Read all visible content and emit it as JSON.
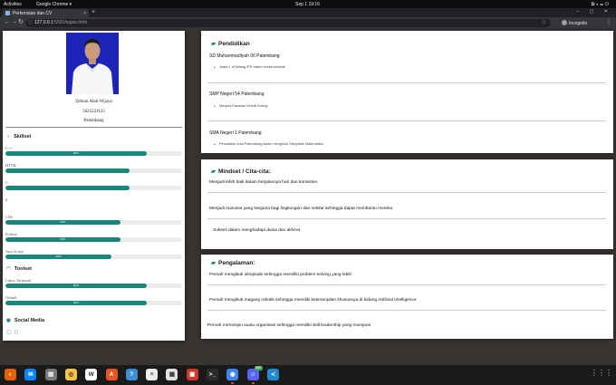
{
  "topbar": {
    "activities": "Activities",
    "app_name": "Google Chrome ▾",
    "clock": "Sep 1  19:16",
    "tray_icons": [
      "network-icon",
      "volume-icon",
      "battery-icon",
      "power-icon"
    ]
  },
  "browser": {
    "tab_title": "Perkenalan dan CV",
    "tab_close": "×",
    "new_tab": "+",
    "window_controls": "– ▢ ✕",
    "url_host": "127.0.0.1",
    "url_path": ":5501/tugas.html",
    "incognito_label": "Incognito",
    "icons": [
      "back-icon",
      "forward-icon",
      "reload-icon",
      "lock-icon",
      "star-icon",
      "menu-icon"
    ]
  },
  "profile": {
    "name": "Zebran Abdi Wijaya",
    "nim": "5025221125",
    "city": "Palembang",
    "photo_color": "#1d24b8"
  },
  "skillset": {
    "heading": "Skillset",
    "items": [
      {
        "name": "C++",
        "percent": 80,
        "label": "80%"
      },
      {
        "name": "HTML",
        "percent": 70,
        "label": ""
      },
      {
        "name": "C",
        "percent": 70,
        "label": ""
      },
      {
        "name": "#",
        "percent": 0,
        "label": ""
      },
      {
        "name": "CSS",
        "percent": 65,
        "label": "65%"
      },
      {
        "name": "Python",
        "percent": 65,
        "label": "65%"
      },
      {
        "name": "Java Script",
        "percent": 60,
        "label": "60%"
      }
    ]
  },
  "toolset": {
    "heading": "Toolset",
    "items": [
      {
        "name": "Linux Terminal",
        "percent": 80,
        "label": "80%"
      },
      {
        "name": "Github",
        "percent": 80,
        "label": "80%"
      }
    ]
  },
  "social": {
    "heading": "Social Media",
    "icons": [
      "github-icon",
      "instagram-icon"
    ]
  },
  "pendidikan": {
    "heading": "Pendidikan",
    "schools": [
      {
        "name": "SD Muhammadiyah 06 Palembang",
        "note": "Juara 1 di bidang IPS dalam lomba sekolah"
      },
      {
        "name": "SMP Negeri 54 Palembang",
        "note": "Menjadi Pasukan Hemat Energi"
      },
      {
        "name": "SMA Negeri 1 Palembang",
        "note": "Perwakilan kota Palembang dalam mengikuti Olimpiade Matematika"
      }
    ]
  },
  "mindset": {
    "heading": "Mindset / Cita-cita:",
    "items": [
      "Menjadi lebih baik dalam berjalannya hari dan konsisten",
      "Menjadi manusia yang berguna bagi lingkungan dan sekitar sehingga dapat membantu mereka",
      "Sukses dalam menghadapi dunia dan akhirat"
    ]
  },
  "pengalaman": {
    "heading": "Pengalaman:",
    "items": [
      "Pernah mengikuti olimpiade sehingga memiliki problem-solving yang lebih",
      "Pernah mengikuti magang robotik sehingga memiliki keterampilan khususnya di bidang Artificial Intelligence",
      "Pernah memimpin suatu organisasi sehingga memiliki skill leadership yang mumpuni"
    ]
  },
  "dock": {
    "apps": [
      {
        "icon": "firefox-icon",
        "color": "#e66000"
      },
      {
        "icon": "thunderbird-icon",
        "color": "#0a84ff"
      },
      {
        "icon": "files-icon",
        "color": "#7a7a7a"
      },
      {
        "icon": "rhythmbox-icon",
        "color": "#f6c445"
      },
      {
        "icon": "libreoffice-writer-icon",
        "color": "#ffffff"
      },
      {
        "icon": "software-center-icon",
        "color": "#e95420"
      },
      {
        "icon": "help-icon",
        "color": "#3d8fd1"
      },
      {
        "icon": "text-editor-icon",
        "color": "#ececec"
      },
      {
        "icon": "document-viewer-icon",
        "color": "#e0e0e0"
      },
      {
        "icon": "libreoffice-impress-icon",
        "color": "#d5392a"
      },
      {
        "icon": "terminal-icon",
        "color": "#2c2c2c"
      },
      {
        "icon": "chrome-icon",
        "color": "#4285f4"
      },
      {
        "icon": "discord-icon",
        "color": "#5865f2"
      },
      {
        "icon": "vscode-icon",
        "color": "#1f8ad2"
      }
    ],
    "discord_badge": "237",
    "grid_label": "⋮⋮⋮"
  }
}
